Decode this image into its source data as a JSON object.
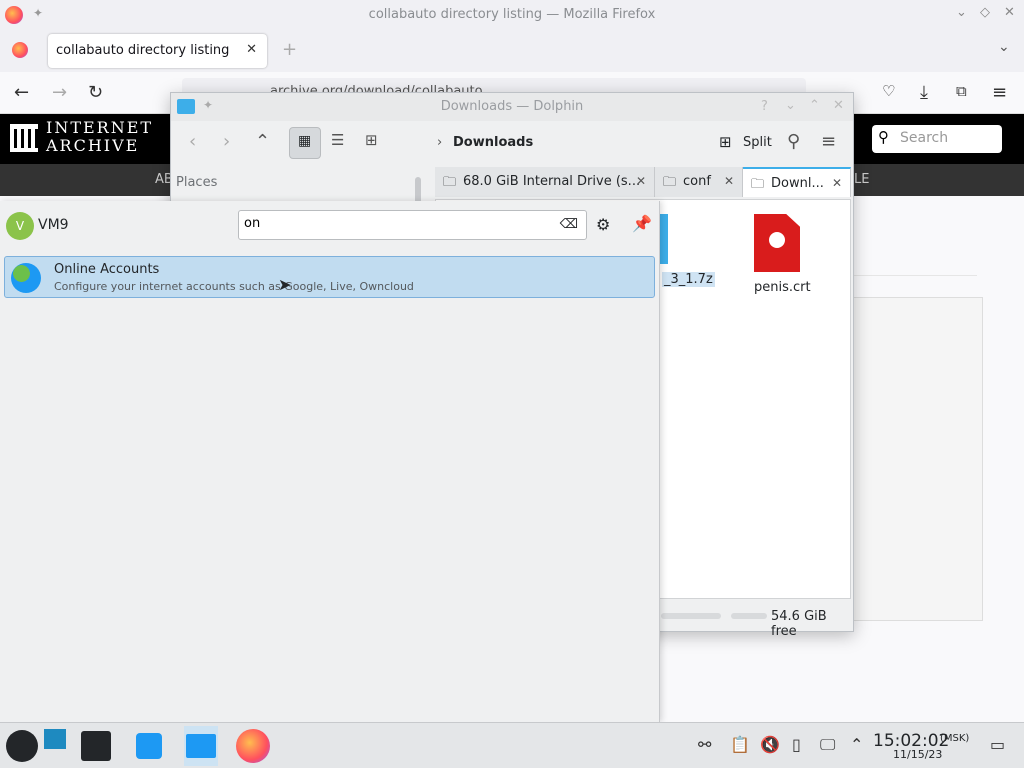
{
  "firefox": {
    "window_title": "collabauto directory listing — Mozilla Firefox",
    "tab_title": "collabauto directory listing",
    "url": "archive.org/download/collabauto"
  },
  "ia": {
    "logo_line1": "INTERNET",
    "logo_line2": "ARCHIVE",
    "search_placeholder": "Search",
    "nav_left": "AB",
    "nav_right": "LE"
  },
  "dolphin": {
    "window_title": "Downloads — Dolphin",
    "breadcrumb": "Downloads",
    "split_label": "Split",
    "places_label": "Places",
    "tabs": [
      {
        "label": "68.0 GiB Internal Drive (s..."
      },
      {
        "label": "conf"
      },
      {
        "label": "Downl..."
      }
    ],
    "files": [
      {
        "name": "_3_1.7z"
      },
      {
        "name": "penis.crt"
      }
    ],
    "free_space": "54.6 GiB free"
  },
  "launcher": {
    "avatar_letter": "V",
    "username": "VM9",
    "search_value": "on",
    "results": [
      {
        "title": "Online Accounts",
        "description": "Configure your internet accounts such as Google, Live, Owncloud"
      }
    ]
  },
  "taskbar": {
    "time": "15:02:02",
    "timezone": "(MSK)",
    "date": "11/15/23"
  }
}
